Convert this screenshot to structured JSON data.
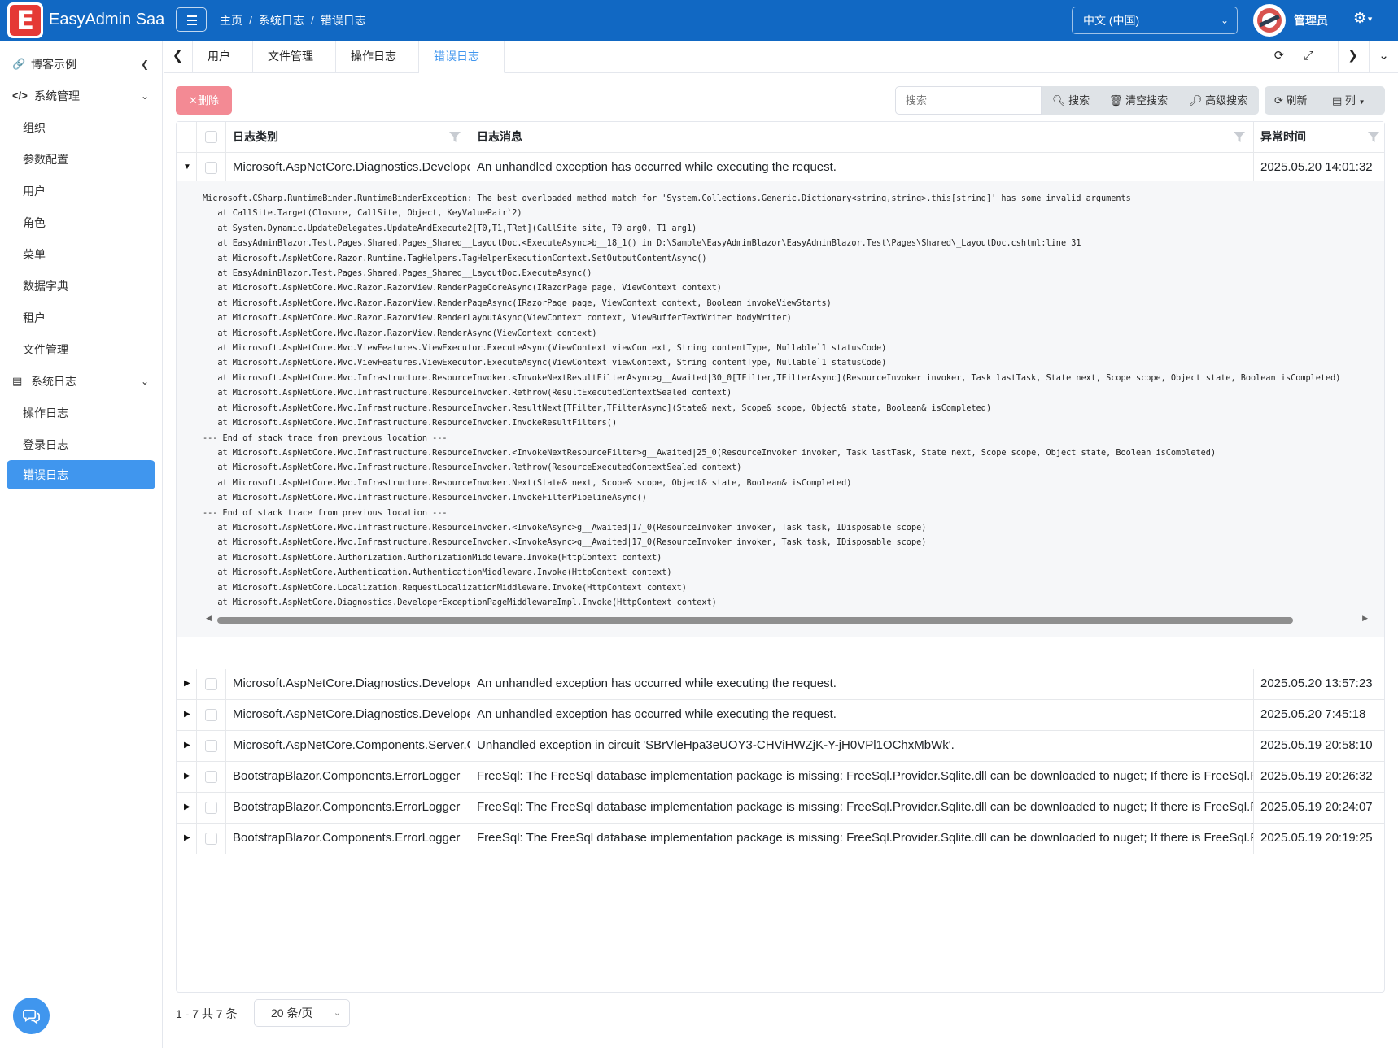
{
  "header": {
    "brand_letter": "E",
    "brand_name": "EasyAdmin Saa",
    "breadcrumb": [
      "主页",
      "系统日志",
      "错误日志"
    ],
    "language": "中文 (中国)",
    "user_name": "管理员"
  },
  "sidebar": {
    "items": [
      {
        "label": "博客示例",
        "icon": "link-icon"
      },
      {
        "label": "系统管理",
        "icon": "code-icon"
      },
      {
        "label": "组织"
      },
      {
        "label": "参数配置"
      },
      {
        "label": "用户"
      },
      {
        "label": "角色"
      },
      {
        "label": "菜单"
      },
      {
        "label": "数据字典"
      },
      {
        "label": "租户"
      },
      {
        "label": "文件管理"
      },
      {
        "label": "系统日志",
        "icon": "server-icon"
      },
      {
        "label": "操作日志"
      },
      {
        "label": "登录日志"
      },
      {
        "label": "错误日志",
        "active": true
      }
    ]
  },
  "tabs": [
    "用户",
    "文件管理",
    "操作日志",
    "错误日志"
  ],
  "toolbar": {
    "delete_label": "删除",
    "search_placeholder": "搜索",
    "search_label": "搜索",
    "clear_search_label": "清空搜索",
    "advanced_search_label": "高级搜索",
    "refresh_label": "刷新",
    "columns_label": "列"
  },
  "table": {
    "headers": [
      "日志类别",
      "日志消息",
      "异常时间"
    ],
    "rows": [
      {
        "category": "Microsoft.AspNetCore.Diagnostics.DeveloperExceptionPageMiddleware",
        "message": "An unhandled exception has occurred while executing the request.",
        "time": "2025.05.20 14:01:32",
        "expanded": true
      },
      {
        "category": "Microsoft.AspNetCore.Diagnostics.DeveloperExceptionPageMiddleware",
        "message": "An unhandled exception has occurred while executing the request.",
        "time": "2025.05.20 13:57:23"
      },
      {
        "category": "Microsoft.AspNetCore.Diagnostics.DeveloperExceptionPageMiddleware",
        "message": "An unhandled exception has occurred while executing the request.",
        "time": "2025.05.20 7:45:18"
      },
      {
        "category": "Microsoft.AspNetCore.Components.Server.Circuits.CircuitHost",
        "message": "Unhandled exception in circuit 'SBrVleHpa3eUOY3-CHViHWZjK-Y-jH0VPl1OChxMbWk'.",
        "time": "2025.05.19 20:58:10"
      },
      {
        "category": "BootstrapBlazor.Components.ErrorLogger",
        "message": "FreeSql: The FreeSql database implementation package is missing: FreeSql.Provider.Sqlite.dll can be downloaded to nuget; If there is FreeSql.Provider.Sqlite.dll",
        "time": "2025.05.19 20:26:32"
      },
      {
        "category": "BootstrapBlazor.Components.ErrorLogger",
        "message": "FreeSql: The FreeSql database implementation package is missing: FreeSql.Provider.Sqlite.dll can be downloaded to nuget; If there is FreeSql.Provider.Sqlite.dll",
        "time": "2025.05.19 20:24:07"
      },
      {
        "category": "BootstrapBlazor.Components.ErrorLogger",
        "message": "FreeSql: The FreeSql database implementation package is missing: FreeSql.Provider.Sqlite.dll can be downloaded to nuget; If there is FreeSql.Provider.Sqlite.dll",
        "time": "2025.05.19 20:19:25"
      }
    ],
    "detail_lines": [
      "Microsoft.CSharp.RuntimeBinder.RuntimeBinderException: The best overloaded method match for 'System.Collections.Generic.Dictionary<string,string>.this[string]' has some invalid arguments",
      "   at CallSite.Target(Closure, CallSite, Object, KeyValuePair`2)",
      "   at System.Dynamic.UpdateDelegates.UpdateAndExecute2[T0,T1,TRet](CallSite site, T0 arg0, T1 arg1)",
      "   at EasyAdminBlazor.Test.Pages.Shared.Pages_Shared__LayoutDoc.<ExecuteAsync>b__18_1() in D:\\Sample\\EasyAdminBlazor\\EasyAdminBlazor.Test\\Pages\\Shared\\_LayoutDoc.cshtml:line 31",
      "   at Microsoft.AspNetCore.Razor.Runtime.TagHelpers.TagHelperExecutionContext.SetOutputContentAsync()",
      "   at EasyAdminBlazor.Test.Pages.Shared.Pages_Shared__LayoutDoc.ExecuteAsync()",
      "   at Microsoft.AspNetCore.Mvc.Razor.RazorView.RenderPageCoreAsync(IRazorPage page, ViewContext context)",
      "   at Microsoft.AspNetCore.Mvc.Razor.RazorView.RenderPageAsync(IRazorPage page, ViewContext context, Boolean invokeViewStarts)",
      "   at Microsoft.AspNetCore.Mvc.Razor.RazorView.RenderLayoutAsync(ViewContext context, ViewBufferTextWriter bodyWriter)",
      "   at Microsoft.AspNetCore.Mvc.Razor.RazorView.RenderAsync(ViewContext context)",
      "   at Microsoft.AspNetCore.Mvc.ViewFeatures.ViewExecutor.ExecuteAsync(ViewContext viewContext, String contentType, Nullable`1 statusCode)",
      "   at Microsoft.AspNetCore.Mvc.ViewFeatures.ViewExecutor.ExecuteAsync(ViewContext viewContext, String contentType, Nullable`1 statusCode)",
      "   at Microsoft.AspNetCore.Mvc.Infrastructure.ResourceInvoker.<InvokeNextResultFilterAsync>g__Awaited|30_0[TFilter,TFilterAsync](ResourceInvoker invoker, Task lastTask, State next, Scope scope, Object state, Boolean isCompleted)",
      "   at Microsoft.AspNetCore.Mvc.Infrastructure.ResourceInvoker.Rethrow(ResultExecutedContextSealed context)",
      "   at Microsoft.AspNetCore.Mvc.Infrastructure.ResourceInvoker.ResultNext[TFilter,TFilterAsync](State& next, Scope& scope, Object& state, Boolean& isCompleted)",
      "   at Microsoft.AspNetCore.Mvc.Infrastructure.ResourceInvoker.InvokeResultFilters()",
      "--- End of stack trace from previous location ---",
      "   at Microsoft.AspNetCore.Mvc.Infrastructure.ResourceInvoker.<InvokeNextResourceFilter>g__Awaited|25_0(ResourceInvoker invoker, Task lastTask, State next, Scope scope, Object state, Boolean isCompleted)",
      "   at Microsoft.AspNetCore.Mvc.Infrastructure.ResourceInvoker.Rethrow(ResourceExecutedContextSealed context)",
      "   at Microsoft.AspNetCore.Mvc.Infrastructure.ResourceInvoker.Next(State& next, Scope& scope, Object& state, Boolean& isCompleted)",
      "   at Microsoft.AspNetCore.Mvc.Infrastructure.ResourceInvoker.InvokeFilterPipelineAsync()",
      "--- End of stack trace from previous location ---",
      "   at Microsoft.AspNetCore.Mvc.Infrastructure.ResourceInvoker.<InvokeAsync>g__Awaited|17_0(ResourceInvoker invoker, Task task, IDisposable scope)",
      "   at Microsoft.AspNetCore.Mvc.Infrastructure.ResourceInvoker.<InvokeAsync>g__Awaited|17_0(ResourceInvoker invoker, Task task, IDisposable scope)",
      "   at Microsoft.AspNetCore.Authorization.AuthorizationMiddleware.Invoke(HttpContext context)",
      "   at Microsoft.AspNetCore.Authentication.AuthenticationMiddleware.Invoke(HttpContext context)",
      "   at Microsoft.AspNetCore.Localization.RequestLocalizationMiddleware.Invoke(HttpContext context)",
      "   at Microsoft.AspNetCore.Diagnostics.DeveloperExceptionPageMiddlewareImpl.Invoke(HttpContext context)"
    ]
  },
  "pagination": {
    "info": "1 - 7 共 7 条",
    "page_size": "20 条/页"
  },
  "colors": {
    "header_bg": "#1168c3",
    "accent": "#4096ee",
    "delete_btn": "#f38a94"
  }
}
